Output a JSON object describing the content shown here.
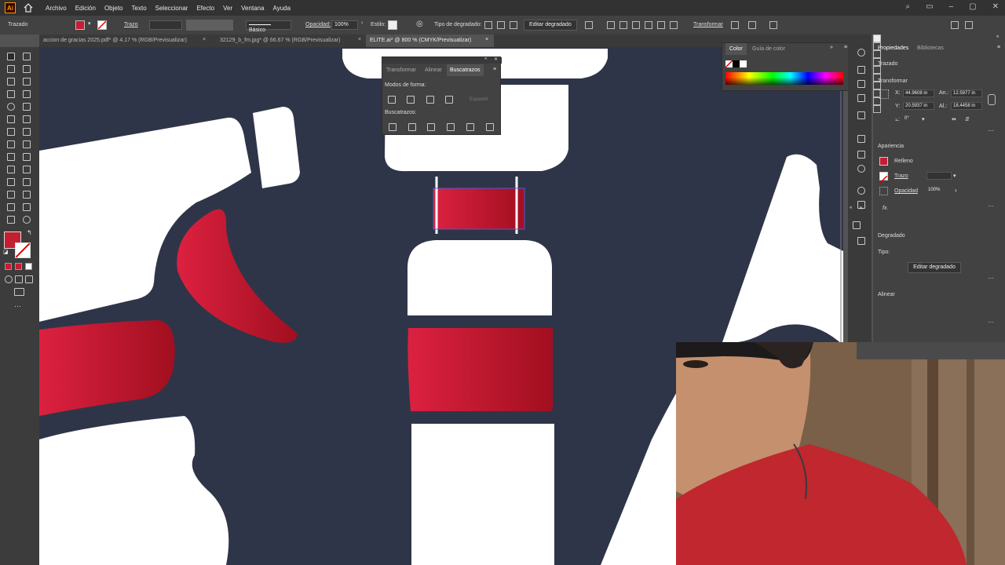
{
  "app": {
    "logo": "Ai",
    "home_icon": "home-icon"
  },
  "menu": [
    "Archivo",
    "Edición",
    "Objeto",
    "Texto",
    "Seleccionar",
    "Efecto",
    "Ver",
    "Ventana",
    "Ayuda"
  ],
  "control_bar": {
    "selection_type": "Trazado",
    "stroke_label": "Trazo",
    "brush_label": "Básico",
    "opacity_label": "Opacidad:",
    "opacity_value": "100%",
    "style_label": "Estilo:",
    "gradient_type_label": "Tipo de degradado:",
    "edit_gradient_button": "Editar degradado",
    "transform_button": "Transformar",
    "fill_color": "#c41e32"
  },
  "tabs": [
    {
      "label": "accion de gracias 2025.pdf* @ 4.17 % (RGB/Previsualizar)",
      "active": false
    },
    {
      "label": "32129_b_fm.jpg* @ 66.67 % (RGB/Previsualizar)",
      "active": false
    },
    {
      "label": "ELITE.ai* @ 800 % (CMYK/Previsualizar)",
      "active": true
    }
  ],
  "pathfinder_panel": {
    "tabs": [
      "Transformar",
      "Alinear",
      "Buscatrazos"
    ],
    "active_tab": "Buscatrazos",
    "shape_modes_label": "Modos de forma:",
    "expand_button": "Expandir",
    "pathfinders_label": "Buscatrazos:"
  },
  "color_panel": {
    "tabs": [
      "Color",
      "Guía de color"
    ],
    "active_tab": "Color"
  },
  "properties_panel": {
    "tabs": [
      "Propiedades",
      "Bibliotecas"
    ],
    "active_tab": "Propiedades",
    "object_type": "Trazado",
    "transform_label": "Transformar",
    "x_label": "X:",
    "x_value": "44.9608 in",
    "y_label": "Y:",
    "y_value": "20.5937 in",
    "w_label": "An.:",
    "w_value": "12.5977 in",
    "h_label": "Al.:",
    "h_value": "18.4458 in",
    "angle_label": "⦣:",
    "angle_value": "0°",
    "appearance_label": "Apariencia",
    "fill_label": "Relleno",
    "stroke_label": "Trazo",
    "opacity_label": "Opacidad",
    "opacity_value": "100%",
    "fx_label": "fx.",
    "gradient_label": "Degradado",
    "type_label": "Tipo:",
    "edit_gradient_button": "Editar degradado",
    "align_label": "Alinear"
  },
  "colors": {
    "accent_red": "#c41e32",
    "canvas_bg": "#2f3548",
    "selection_blue": "#4a5bd1"
  }
}
